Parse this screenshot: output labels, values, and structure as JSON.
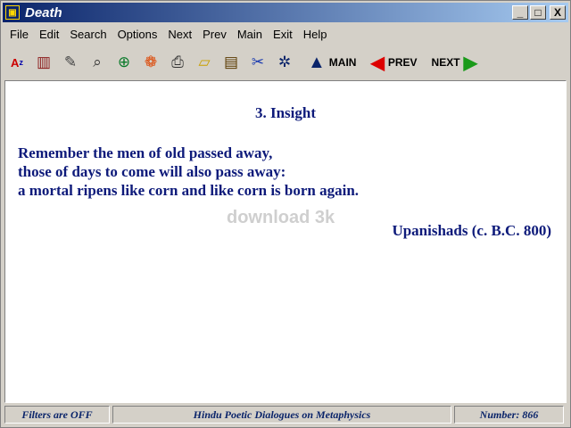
{
  "window": {
    "title": "Death",
    "min_label": "_",
    "max_label": "□",
    "close_label": "X"
  },
  "menu": [
    {
      "label": "File"
    },
    {
      "label": "Edit"
    },
    {
      "label": "Search"
    },
    {
      "label": "Options"
    },
    {
      "label": "Next"
    },
    {
      "label": "Prev"
    },
    {
      "label": "Main"
    },
    {
      "label": "Exit"
    },
    {
      "label": "Help"
    }
  ],
  "toolbar": {
    "main_label": "MAIN",
    "prev_label": "PREV",
    "next_label": "NEXT"
  },
  "content": {
    "title": "3. Insight",
    "lines": [
      "Remember the men of old passed away,",
      "those of days to come will also pass away:",
      "a mortal ripens like corn and like corn is born again."
    ],
    "author": "Upanishads (c. B.C. 800)",
    "watermark": "download 3k"
  },
  "status": {
    "filters": "Filters are OFF",
    "book": "Hindu Poetic Dialogues on Metaphysics",
    "number_label": "Number:",
    "number_value": "866"
  },
  "colors": {
    "text": "#0d1a7a",
    "title_start": "#0a246a",
    "title_end": "#a6caf0"
  }
}
